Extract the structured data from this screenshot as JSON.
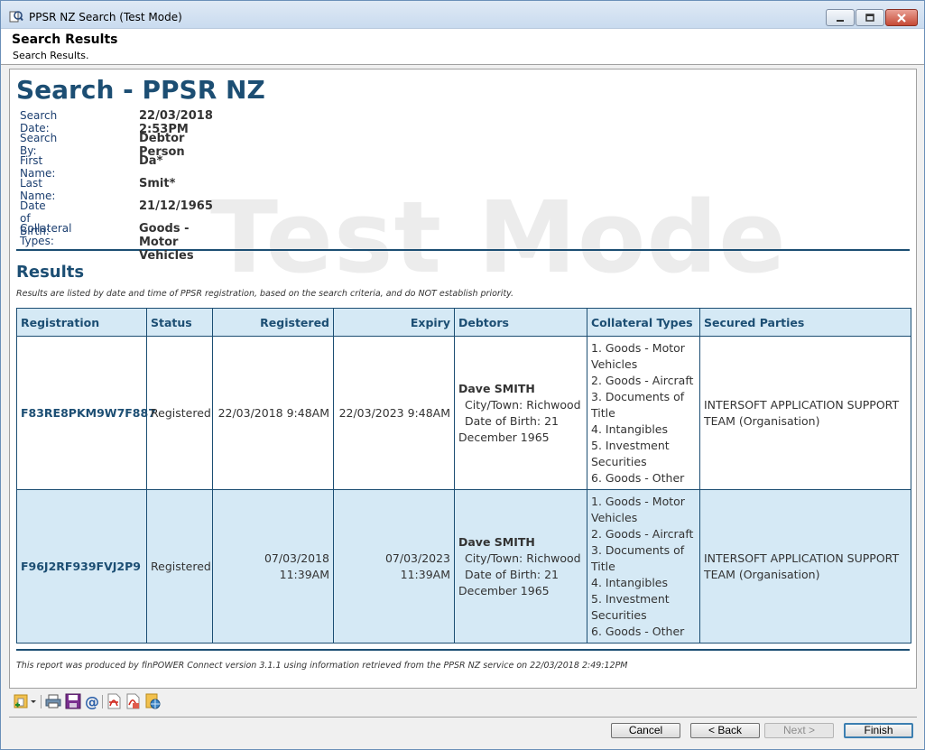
{
  "window": {
    "title": "PPSR NZ Search (Test Mode)"
  },
  "header": {
    "title": "Search Results",
    "subtitle": "Search Results."
  },
  "report": {
    "title": "Search - PPSR NZ",
    "watermark": "Test Mode",
    "criteria": [
      {
        "label": "Search Date:",
        "value": "22/03/2018 2:53PM"
      },
      {
        "label": "Search By:",
        "value": "Debtor Person"
      },
      {
        "label": "First Name:",
        "value": "Da*"
      },
      {
        "label": "Last Name:",
        "value": "Smit*"
      },
      {
        "label": "Date of Birth:",
        "value": "21/12/1965"
      },
      {
        "label": "Collateral Types:",
        "value": "Goods - Motor Vehicles"
      }
    ],
    "results_title": "Results",
    "results_note": "Results are listed by date and time of PPSR registration, based on the search criteria, and do NOT establish priority.",
    "columns": [
      "Registration",
      "Status",
      "Registered",
      "Expiry",
      "Debtors",
      "Collateral Types",
      "Secured Parties"
    ],
    "rows": [
      {
        "registration": "F83RE8PKM9W7F887",
        "status": "Registered",
        "registered": "22/03/2018 9:48AM",
        "expiry": "22/03/2023 9:48AM",
        "debtor_name": "Dave SMITH",
        "debtor_city": "City/Town: Richwood",
        "debtor_dob_a": "Date of Birth: 21",
        "debtor_dob_b": "December 1965",
        "collateral": [
          "1. Goods - Motor Vehicles",
          "2. Goods - Aircraft",
          "3. Documents of Title",
          "4. Intangibles",
          "5. Investment Securities",
          "6. Goods - Other"
        ],
        "secured_party": "INTERSOFT APPLICATION SUPPORT TEAM (Organisation)"
      },
      {
        "registration": "F96J2RF939FVJ2P9",
        "status": "Registered",
        "registered": "07/03/2018 11:39AM",
        "expiry": "07/03/2023 11:39AM",
        "debtor_name": "Dave SMITH",
        "debtor_city": "City/Town: Richwood",
        "debtor_dob_a": "Date of Birth: 21",
        "debtor_dob_b": "December 1965",
        "collateral": [
          "1. Goods - Motor Vehicles",
          "2. Goods - Aircraft",
          "3. Documents of Title",
          "4. Intangibles",
          "5. Investment Securities",
          "6. Goods - Other"
        ],
        "secured_party": "INTERSOFT APPLICATION SUPPORT TEAM (Organisation)"
      }
    ],
    "footer_note": "This report was produced by finPOWER Connect version 3.1.1 using information retrieved from the PPSR NZ service on 22/03/2018 2:49:12PM"
  },
  "toolbar": {
    "icons": [
      "new-document-icon",
      "print-icon",
      "save-icon",
      "email-icon",
      "pdf-icon",
      "pdf-options-icon",
      "web-document-icon"
    ]
  },
  "buttons": {
    "cancel": "Cancel",
    "back": "< Back",
    "next": "Next >",
    "finish": "Finish"
  },
  "colors": {
    "heading_blue": "#1c4e73",
    "row_alt": "#d5e9f5"
  }
}
